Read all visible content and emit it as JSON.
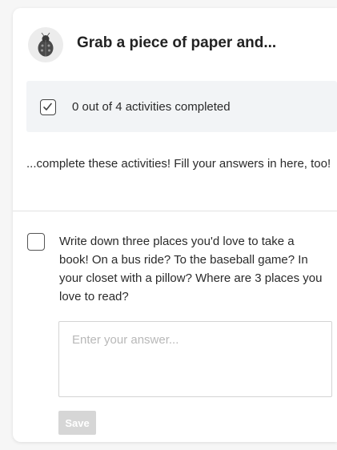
{
  "header": {
    "icon": "ladybug-icon",
    "title": "Grab a piece of paper and..."
  },
  "progress": {
    "checked": true,
    "text": "0 out of 4 activities completed",
    "completed": 0,
    "total": 4
  },
  "intro": {
    "text": "...complete these activities! Fill your answers in here, too!"
  },
  "activity": {
    "checked": false,
    "text": "Write down three places you'd love to take a book! On a bus ride? To the baseball game? In your closet with a pillow? Where are 3 places you love to read?",
    "answer_value": "",
    "answer_placeholder": "Enter your answer...",
    "save_label": "Save"
  },
  "colors": {
    "progress_background": "#f2f4f6",
    "save_disabled": "#d6d6d6",
    "text": "#2a2a2a"
  }
}
